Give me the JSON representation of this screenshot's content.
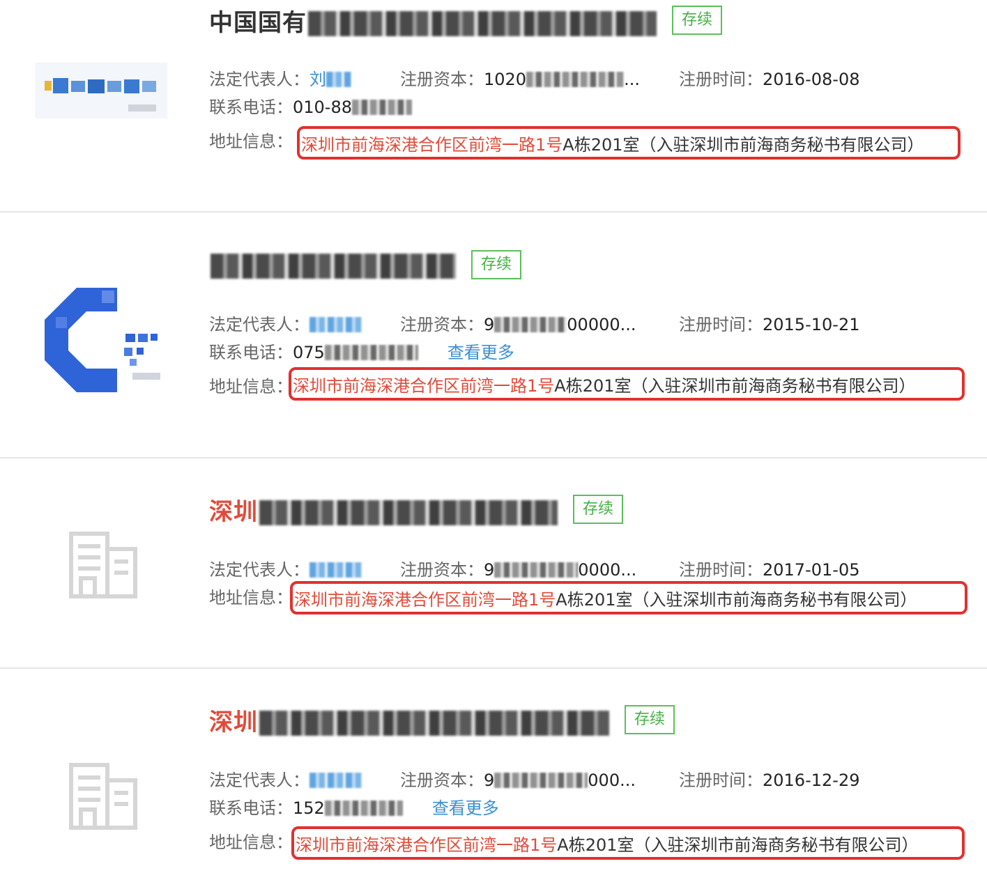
{
  "labels": {
    "legal_rep": "法定代表人：",
    "capital": "注册资本：",
    "reg_date": "注册时间：",
    "phone": "联系电话：",
    "address": "地址信息：",
    "view_more": "查看更多"
  },
  "status_badge": "存续",
  "address": {
    "part_red": "深圳市前海深港合作区前湾一路1号",
    "part_dark": "A栋201室（入驻深圳市前海商务秘书有限公司）"
  },
  "companies": [
    {
      "name_visible": "中国国有",
      "legal_rep_visible": "刘",
      "capital_visible": "1020",
      "capital_tail": "...",
      "reg_date": "2016-08-08",
      "phone_visible": "010-88"
    },
    {
      "name_visible": "",
      "legal_rep_visible": "",
      "capital_visible": "9",
      "capital_tail": "00000...",
      "reg_date": "2015-10-21",
      "phone_visible": "075"
    },
    {
      "name_visible": "深圳",
      "legal_rep_visible": "",
      "capital_visible": "9",
      "capital_tail": "0000...",
      "reg_date": "2017-01-05"
    },
    {
      "name_visible": "深圳",
      "legal_rep_visible": "",
      "capital_visible": "9",
      "capital_tail": "000...",
      "reg_date": "2016-12-29",
      "phone_visible": "152"
    }
  ],
  "colors": {
    "status_green": "#44b044",
    "highlight_red": "#e0312f",
    "name_red": "#e14b39",
    "link_blue": "#3b8fd0"
  },
  "icons": [
    "company-logo-pixelated",
    "company-logo-c",
    "building-placeholder-icon"
  ]
}
